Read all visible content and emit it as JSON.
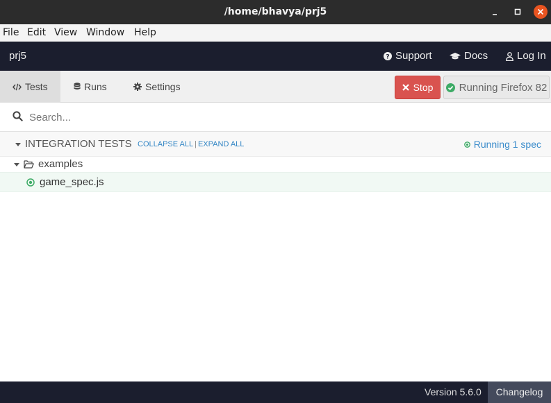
{
  "window": {
    "title": "/home/bhavya/prj5"
  },
  "menubar": {
    "items": [
      "File",
      "Edit",
      "View",
      "Window",
      "Help"
    ]
  },
  "header": {
    "project_name": "prj5",
    "support_label": "Support",
    "docs_label": "Docs",
    "login_label": "Log In"
  },
  "toolbar": {
    "tabs": [
      {
        "label": "Tests",
        "icon": "code-icon",
        "active": true
      },
      {
        "label": "Runs",
        "icon": "database-icon",
        "active": false
      },
      {
        "label": "Settings",
        "icon": "gear-icon",
        "active": false
      }
    ],
    "stop_label": "Stop",
    "browser_label": "Running Firefox 82"
  },
  "search": {
    "placeholder": "Search...",
    "value": ""
  },
  "specs": {
    "section_title": "INTEGRATION TESTS",
    "collapse_all": "COLLAPSE ALL",
    "separator": "|",
    "expand_all": "EXPAND ALL",
    "running_status": "Running 1 spec",
    "folder_name": "examples",
    "file_name": "game_spec.js"
  },
  "footer": {
    "version": "Version 5.6.0",
    "changelog": "Changelog"
  },
  "colors": {
    "header_bg": "#1b1e2e",
    "stop_red": "#d9534f",
    "running_green": "#3dab66",
    "link_blue": "#3386c5",
    "close_orange": "#e95420"
  }
}
